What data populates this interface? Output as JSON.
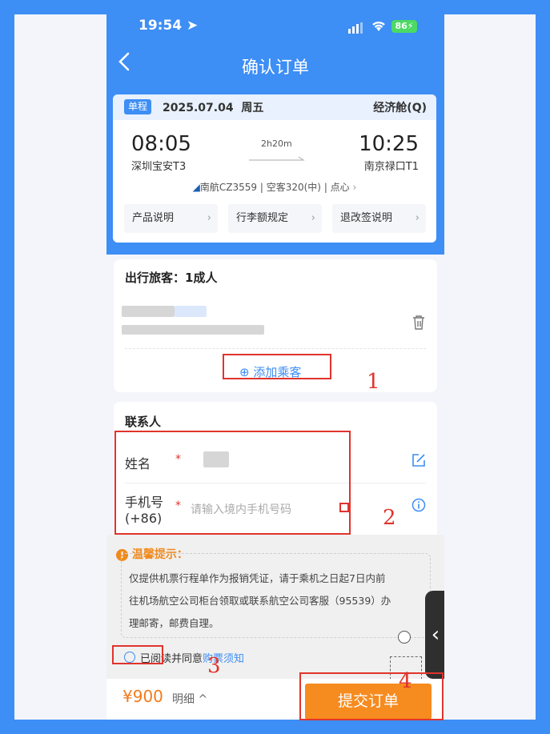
{
  "status_bar": {
    "time": "19:54",
    "battery": "86"
  },
  "nav": {
    "back_label": "‹",
    "title": "确认订单"
  },
  "flight": {
    "trip_type": "单程",
    "date": "2025.07.04",
    "weekday": "周五",
    "cabin": "经济舱(Q)",
    "depart_time": "08:05",
    "depart_airport": "深圳宝安T3",
    "duration": "2h20m",
    "arrive_time": "10:25",
    "arrive_airport": "南京禄口T1",
    "airline_info": "南航CZ3559",
    "aircraft": "空客320(中)",
    "meal": "点心",
    "buttons": [
      "产品说明",
      "行李额规定",
      "退改签说明"
    ]
  },
  "passengers": {
    "title": "出行旅客：1成人",
    "add_label": "添加乘客"
  },
  "contact": {
    "title": "联系人",
    "name_label": "姓名",
    "required_mark": "*",
    "phone_label": "手机号",
    "phone_code": "(+86)",
    "phone_placeholder": "请输入境内手机号码"
  },
  "notice": {
    "title": "温馨提示：",
    "lines": [
      "仅提供机票行程单作为报销凭证，请于乘机之日起7日内前",
      "往机场航空公司柜台领取或联系航空公司客服（95539）办",
      "理邮寄，邮费自理。"
    ]
  },
  "agreement": {
    "prefix": "已阅读并同意",
    "link": "购票须知"
  },
  "footer": {
    "price": "¥900",
    "detail_label": "明细"
  },
  "submit_label": "提交订单",
  "annotations": [
    "1",
    "2",
    "3",
    "4"
  ],
  "colors": {
    "brand_blue": "#3d8ef5",
    "submit_orange": "#f68b1f",
    "price_orange": "#f37b1d",
    "annotation_red": "#e0342c"
  }
}
